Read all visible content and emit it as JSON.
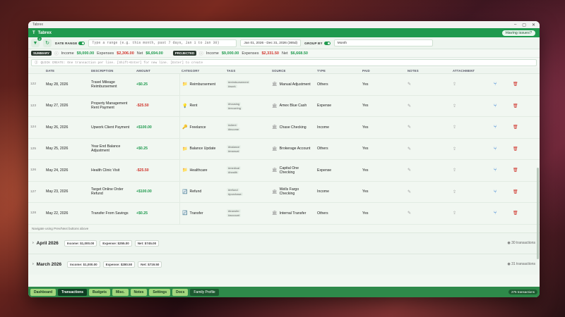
{
  "os_window": {
    "title": "Tabrex",
    "controls": [
      "–",
      "▢",
      "✕"
    ]
  },
  "app": {
    "name": "Tabrex",
    "issues_label": "Having issues?"
  },
  "toolbar": {
    "filter_badge": "2",
    "date_range_label": "DATE RANGE",
    "date_placeholder": "Type a range (e.g. this month, past 7 days, Jan 1 to Jan 30)",
    "date_value": "Jan 01, 2026 - Dec 31, 2026 (365d)",
    "group_by_label": "GROUP BY",
    "group_by_value": "Month"
  },
  "summary": {
    "label": "SUMMARY",
    "income_label": "Income",
    "income": "$9,000.00",
    "expenses_label": "Expenses",
    "expenses": "$2,306.00",
    "net_label": "Net",
    "net": "$6,694.00",
    "projected_label": "PROJECTED",
    "p_income_label": "Income",
    "p_income": "$9,000.00",
    "p_expenses_label": "Expenses",
    "p_expenses": "$2,331.50",
    "p_net_label": "Net",
    "p_net": "$6,668.50"
  },
  "quick_create": {
    "placeholder": "QUICK CREATE: One transaction per line. [Shift+Enter] for new line. [Enter] to create"
  },
  "table": {
    "headers": [
      "",
      "DATE",
      "DESCRIPTION",
      "AMOUNT",
      "CATEGORY",
      "TAGS",
      "SOURCE",
      "TYPE",
      "PAID",
      "NOTES",
      "ATTACHMENT",
      "",
      ""
    ],
    "rows": [
      {
        "idx": "122",
        "date": "May 28, 2026",
        "desc": "Travel Mileage Reimbursement",
        "amount": "+$0.25",
        "sign": "pos",
        "cat_icon": "📁",
        "category": "Reimbursement",
        "tags": [
          "#reimbursement",
          "#work"
        ],
        "source": "Manual Adjustment",
        "type": "Others",
        "paid": "Yes"
      },
      {
        "idx": "123",
        "date": "May 27, 2026",
        "desc": "Property Management Rent Payment",
        "amount": "-$25.50",
        "sign": "neg",
        "cat_icon": "💡",
        "category": "Rent",
        "tags": [
          "#housing",
          "#recurring"
        ],
        "source": "Amex Blue Cash",
        "type": "Expense",
        "paid": "Yes"
      },
      {
        "idx": "124",
        "date": "May 26, 2026",
        "desc": "Upwork Client Payment",
        "amount": "+$100.00",
        "sign": "pos",
        "cat_icon": "🔑",
        "category": "Freelance",
        "tags": [
          "#client",
          "#income"
        ],
        "source": "Chase Checking",
        "type": "Income",
        "paid": "Yes"
      },
      {
        "idx": "125",
        "date": "May 25, 2026",
        "desc": "Year End Balance Adjustment",
        "amount": "+$0.25",
        "sign": "pos",
        "cat_icon": "📁",
        "category": "Balance Update",
        "tags": [
          "#balance",
          "#manual"
        ],
        "source": "Brokerage Account",
        "type": "Others",
        "paid": "Yes"
      },
      {
        "idx": "126",
        "date": "May 24, 2026",
        "desc": "Health Clinic Visit",
        "amount": "-$25.50",
        "sign": "neg",
        "cat_icon": "📁",
        "category": "Healthcare",
        "tags": [
          "#medical",
          "#health"
        ],
        "source": "Capital One Checking",
        "type": "Expense",
        "paid": "Yes"
      },
      {
        "idx": "127",
        "date": "May 23, 2026",
        "desc": "Target Online Order Refund",
        "amount": "+$100.00",
        "sign": "pos",
        "cat_icon": "🔄",
        "category": "Refund",
        "tags": [
          "#refund",
          "#purchase"
        ],
        "source": "Wells Fargo Checking",
        "type": "Income",
        "paid": "Yes"
      },
      {
        "idx": "128",
        "date": "May 22, 2026",
        "desc": "Transfer From Savings",
        "amount": "+$0.25",
        "sign": "pos",
        "cat_icon": "🔄",
        "category": "Transfer",
        "tags": [
          "#transfer",
          "#account"
        ],
        "source": "Internal Transfer",
        "type": "Others",
        "paid": "Yes"
      }
    ]
  },
  "nav_hint": "Navigate using Prev/Next buttons above",
  "groups": [
    {
      "title": "April 2026",
      "income": "Income: $1,000.00",
      "expense": "Expense: $255.00",
      "net": "Net: $745.00",
      "count": "30 transactions"
    },
    {
      "title": "March 2026",
      "income": "Income: $1,000.00",
      "expense": "Expense: $280.50",
      "net": "Net: $719.50",
      "count": "31 transactions"
    }
  ],
  "bottom_tabs": [
    "Dashboard",
    "Transactions",
    "Budgets",
    "Misc.",
    "Notes",
    "Settings",
    "Docs"
  ],
  "profile": "Family Profile",
  "total_count": "275 transactions",
  "colors": {
    "brand": "#1f9a4e",
    "income": "#1f9a4e",
    "expense": "#d0342c"
  }
}
